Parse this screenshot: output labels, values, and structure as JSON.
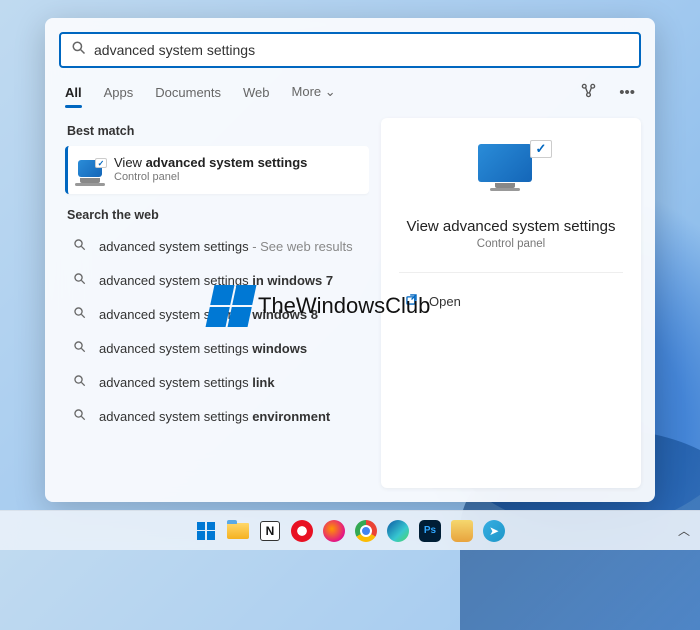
{
  "search": {
    "value": "advanced system settings"
  },
  "tabs": {
    "all": "All",
    "apps": "Apps",
    "documents": "Documents",
    "web": "Web",
    "more": "More"
  },
  "sections": {
    "best_match": "Best match",
    "search_web": "Search the web"
  },
  "best_match": {
    "title_pre": "View ",
    "title_bold": "advanced system settings",
    "subtitle": "Control panel"
  },
  "web_results": [
    {
      "plain": "advanced system settings",
      "bold": "",
      "suffix": " - See web results"
    },
    {
      "plain": "advanced system settings ",
      "bold": "in windows 7",
      "suffix": ""
    },
    {
      "plain": "advanced system settings ",
      "bold": "windows 8",
      "suffix": ""
    },
    {
      "plain": "advanced system settings ",
      "bold": "windows",
      "suffix": ""
    },
    {
      "plain": "advanced system settings ",
      "bold": "link",
      "suffix": ""
    },
    {
      "plain": "advanced system settings ",
      "bold": "environment",
      "suffix": ""
    }
  ],
  "preview": {
    "title": "View advanced system settings",
    "subtitle": "Control panel",
    "action_open": "Open"
  },
  "watermark": "TheWindowsClub",
  "taskbar": {
    "notion_letter": "N",
    "ps_label": "Ps",
    "telegram_glyph": "➤"
  }
}
